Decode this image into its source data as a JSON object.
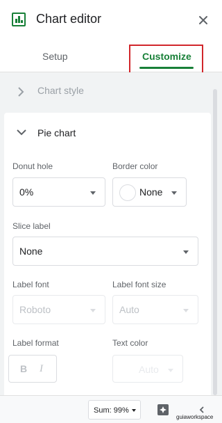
{
  "header": {
    "title": "Chart editor",
    "logo_icon": "sheets-chart-icon",
    "close_icon": "close-icon"
  },
  "tabs": {
    "setup": "Setup",
    "customize": "Customize",
    "active": "Customize",
    "accent_color": "#188038",
    "highlight_color": "#d1262b"
  },
  "sections": {
    "chart_style": {
      "label": "Chart style",
      "expanded": false
    },
    "pie_chart": {
      "label": "Pie chart",
      "expanded": true
    }
  },
  "pie_chart": {
    "donut_hole": {
      "label": "Donut hole",
      "value": "0%"
    },
    "border_color": {
      "label": "Border color",
      "value": "None"
    },
    "slice_label": {
      "label": "Slice label",
      "value": "None"
    },
    "label_font": {
      "label": "Label font",
      "value": "Roboto",
      "disabled": true
    },
    "label_font_size": {
      "label": "Label font size",
      "value": "Auto",
      "disabled": true
    },
    "label_format": {
      "label": "Label format",
      "bold": "B",
      "italic": "I"
    },
    "text_color": {
      "label": "Text color",
      "value": "Auto",
      "disabled": true
    }
  },
  "footer": {
    "sum": "Sum: 99%",
    "explore_icon": "explore-icon",
    "collapse_icon": "chevron-left-icon"
  },
  "watermark": "guiaworkspace"
}
